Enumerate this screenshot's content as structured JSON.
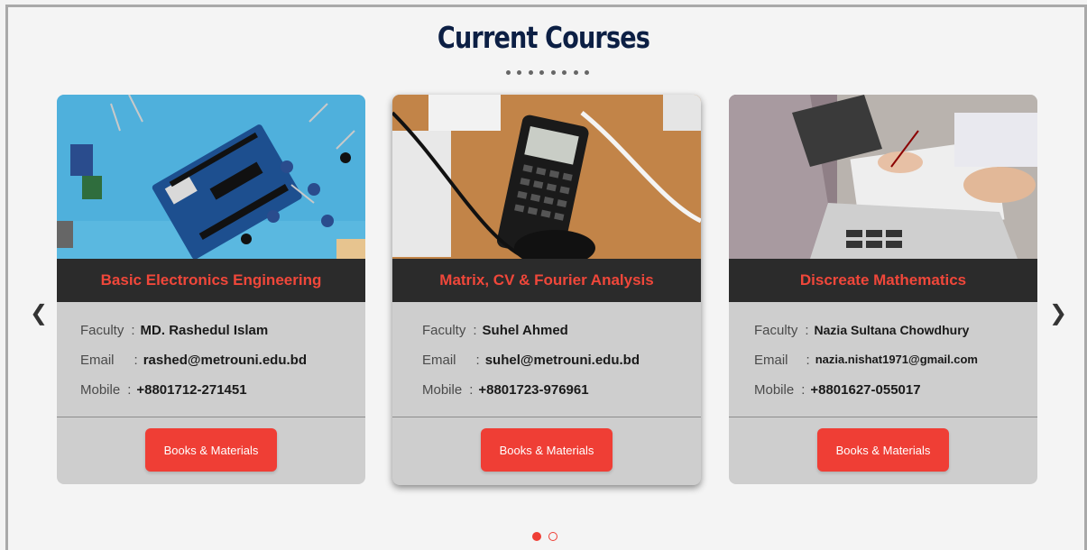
{
  "header": {
    "title": "Current Courses"
  },
  "carousel": {
    "prev_icon": "❮",
    "next_icon": "❯",
    "page_count": 2,
    "active_page": 1
  },
  "labels": {
    "faculty": "Faculty",
    "email": "Email",
    "mobile": "Mobile",
    "separator": ":"
  },
  "courses": [
    {
      "title": "Basic Electronics Engineering",
      "image_icon": "arduino-electronics-photo",
      "faculty": "MD. Rashedul Islam",
      "email": "rashed@metrouni.edu.bd",
      "mobile": "+8801712-271451",
      "button_label": "Books & Materials"
    },
    {
      "title": "Matrix, CV & Fourier Analysis",
      "image_icon": "calculator-desk-photo",
      "faculty": "Suhel Ahmed",
      "email": "suhel@metrouni.edu.bd",
      "mobile": "+8801723-976961",
      "button_label": "Books & Materials"
    },
    {
      "title": "Discreate Mathematics",
      "image_icon": "laptop-writing-photo",
      "faculty": "Nazia Sultana Chowdhury",
      "email": "nazia.nishat1971@gmail.com",
      "mobile": "+8801627-055017",
      "button_label": "Books & Materials"
    }
  ],
  "colors": {
    "accent": "#ef3e35",
    "title_bar": "#2b2b2b",
    "heading": "#0c1f44",
    "card_bg": "#cecece"
  }
}
